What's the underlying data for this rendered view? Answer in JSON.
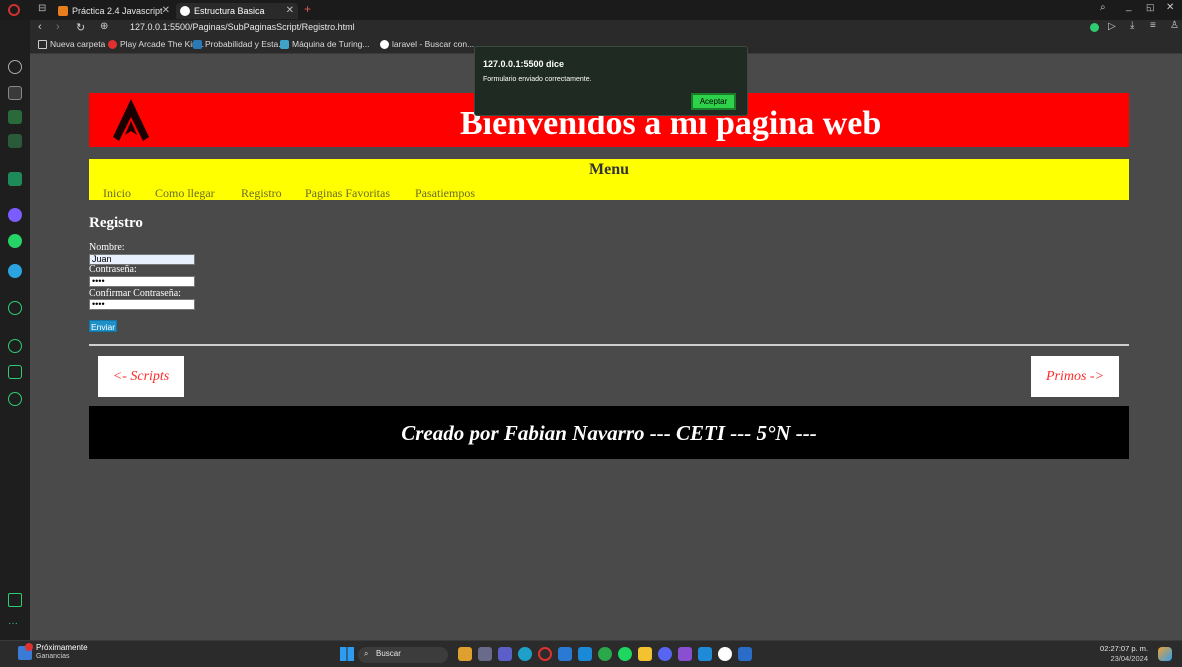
{
  "browser": {
    "tabs": [
      {
        "label": "Práctica 2.4 Javascript",
        "active": false
      },
      {
        "label": "Estructura Basica",
        "active": true
      }
    ],
    "url": "127.0.0.1:5500/Paginas/SubPaginasScript/Registro.html",
    "bookmarks": [
      "Nueva carpeta",
      "Play Arcade The Kin...",
      "Probabilidad y Esta...",
      "Máquina de Turing...",
      "laravel - Buscar con..."
    ]
  },
  "page": {
    "header_title": "Bienvenidos a mi pagina web",
    "menu_title": "Menu",
    "menu_links": [
      "Inicio",
      "Como llegar",
      "Registro",
      "Paginas Favoritas",
      "Pasatiempos"
    ],
    "form": {
      "title": "Registro",
      "name_label": "Nombre:",
      "name_value": "Juan",
      "password_label": "Contraseña:",
      "password_value": "••••",
      "confirm_label": "Confirmar Contraseña:",
      "confirm_value": "••••",
      "submit_label": "Enviar"
    },
    "prev_link": "<- Scripts",
    "next_link": "Primos ->",
    "footer_text": "Creado por Fabian Navarro --- CETI --- 5°N ---"
  },
  "dialog": {
    "title": "127.0.0.1:5500 dice",
    "message": "Formulario enviado correctamente.",
    "ok_label": "Aceptar"
  },
  "taskbar": {
    "news_title": "Próximamente",
    "news_sub": "Ganancias",
    "search_label": "Buscar",
    "time": "02:27:07 p. m.",
    "date": "23/04/2024"
  },
  "colors": {
    "header": "#ff0000",
    "menu": "#ffff00",
    "footer": "#000000",
    "page_bg": "#4a4a4a",
    "dialog_button": "#2ed14a"
  }
}
